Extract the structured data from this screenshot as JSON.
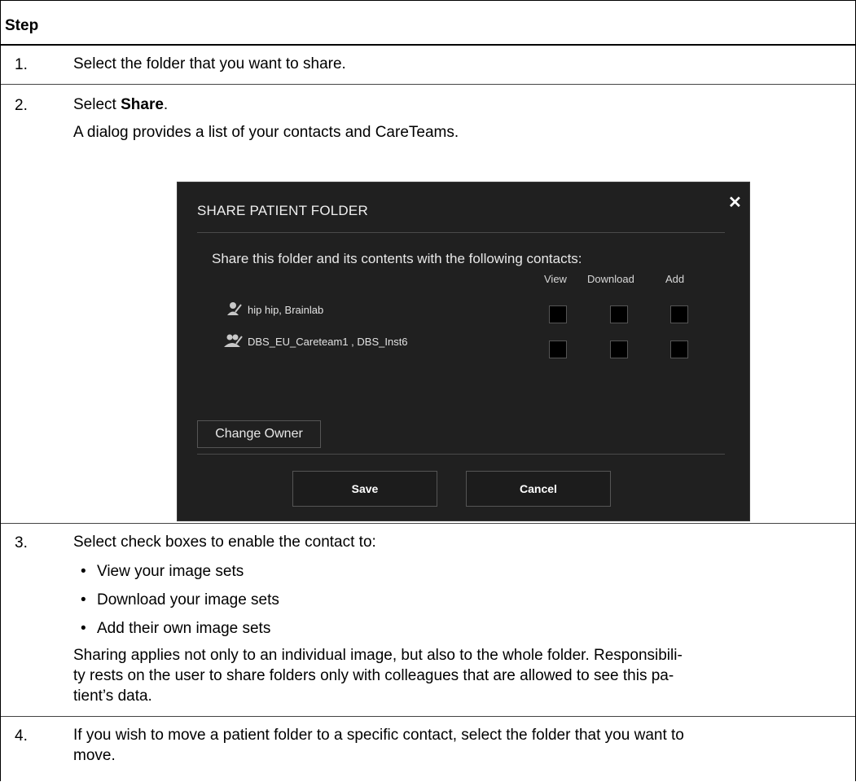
{
  "table": {
    "header": "Step",
    "steps": [
      {
        "number": "1.",
        "lines": [
          "Select the folder that you want to share."
        ]
      },
      {
        "number": "2.",
        "line1_prefix": "Select ",
        "line1_bold": "Share",
        "line1_suffix": ".",
        "line2": "A dialog provides a list of your contacts and CareTeams."
      },
      {
        "number": "3.",
        "line1": "Select check boxes to enable the contact to:",
        "bullets": [
          "View your image sets",
          "Download your image sets",
          "Add their own image sets"
        ],
        "para": [
          "Sharing applies not only to an individual image, but also to the whole folder. Responsibili-",
          "ty rests on the user to share folders only with colleagues that are allowed to see this pa-",
          "tient’s data."
        ]
      },
      {
        "number": "4.",
        "lines": [
          "If you wish to move a patient folder to a specific contact, select the folder that you want to",
          "move."
        ]
      }
    ]
  },
  "dialog": {
    "title": "SHARE PATIENT FOLDER",
    "close_glyph": "✕",
    "instruction": "Share this folder and its contents with the following contacts:",
    "columns": [
      "View",
      "Download",
      "Add"
    ],
    "contacts": [
      {
        "name": "hip hip, Brainlab",
        "icon": "user-icon",
        "view": false,
        "download": false,
        "add": false
      },
      {
        "name": "DBS_EU_Careteam1 , DBS_Inst6",
        "icon": "group-icon",
        "view": false,
        "download": false,
        "add": false
      }
    ],
    "change_owner_label": "Change Owner",
    "save_label": "Save",
    "cancel_label": "Cancel"
  },
  "colors": {
    "dialog_bg": "#202020",
    "checkbox": "#000000",
    "text_light": "#e6e6e6"
  }
}
